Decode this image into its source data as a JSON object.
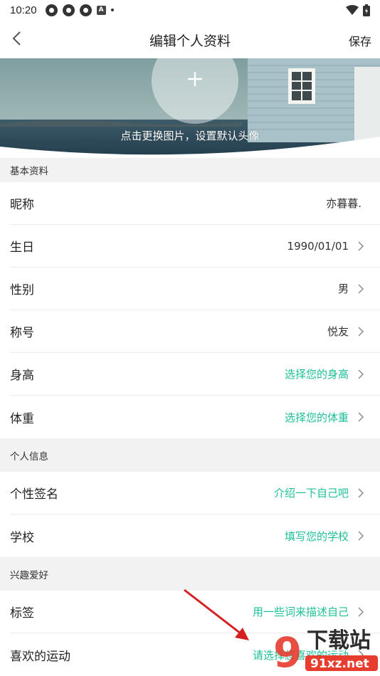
{
  "status_bar": {
    "time": "10:20",
    "a_icon": "A"
  },
  "header": {
    "title": "编辑个人资料",
    "save_label": "保存"
  },
  "banner": {
    "caption": "点击更换图片，设置默认头像"
  },
  "sections": [
    {
      "title": "基本资料",
      "rows": [
        {
          "label": "昵称",
          "value": "亦暮暮.",
          "hint": false,
          "chevron": false
        },
        {
          "label": "生日",
          "value": "1990/01/01",
          "hint": false,
          "chevron": true
        },
        {
          "label": "性别",
          "value": "男",
          "hint": false,
          "chevron": true
        },
        {
          "label": "称号",
          "value": "悦友",
          "hint": false,
          "chevron": true
        },
        {
          "label": "身高",
          "value": "选择您的身高",
          "hint": true,
          "chevron": true
        },
        {
          "label": "体重",
          "value": "选择您的体重",
          "hint": true,
          "chevron": true
        }
      ]
    },
    {
      "title": "个人信息",
      "rows": [
        {
          "label": "个性签名",
          "value": "介绍一下自己吧",
          "hint": true,
          "chevron": true
        },
        {
          "label": "学校",
          "value": "填写您的学校",
          "hint": true,
          "chevron": true
        }
      ]
    },
    {
      "title": "兴趣爱好",
      "rows": [
        {
          "label": "标签",
          "value": "用一些词来描述自己",
          "hint": true,
          "chevron": true
        },
        {
          "label": "喜欢的运动",
          "value": "请选择您喜欢的运动",
          "hint": true,
          "chevron": true
        }
      ]
    }
  ],
  "watermark": {
    "brand": "下载站",
    "domain": "91xz.net",
    "numeral": "9"
  },
  "colors": {
    "hint": "#1dbf98",
    "section_bg": "#f2f2f2",
    "arrow": "#d42020"
  }
}
